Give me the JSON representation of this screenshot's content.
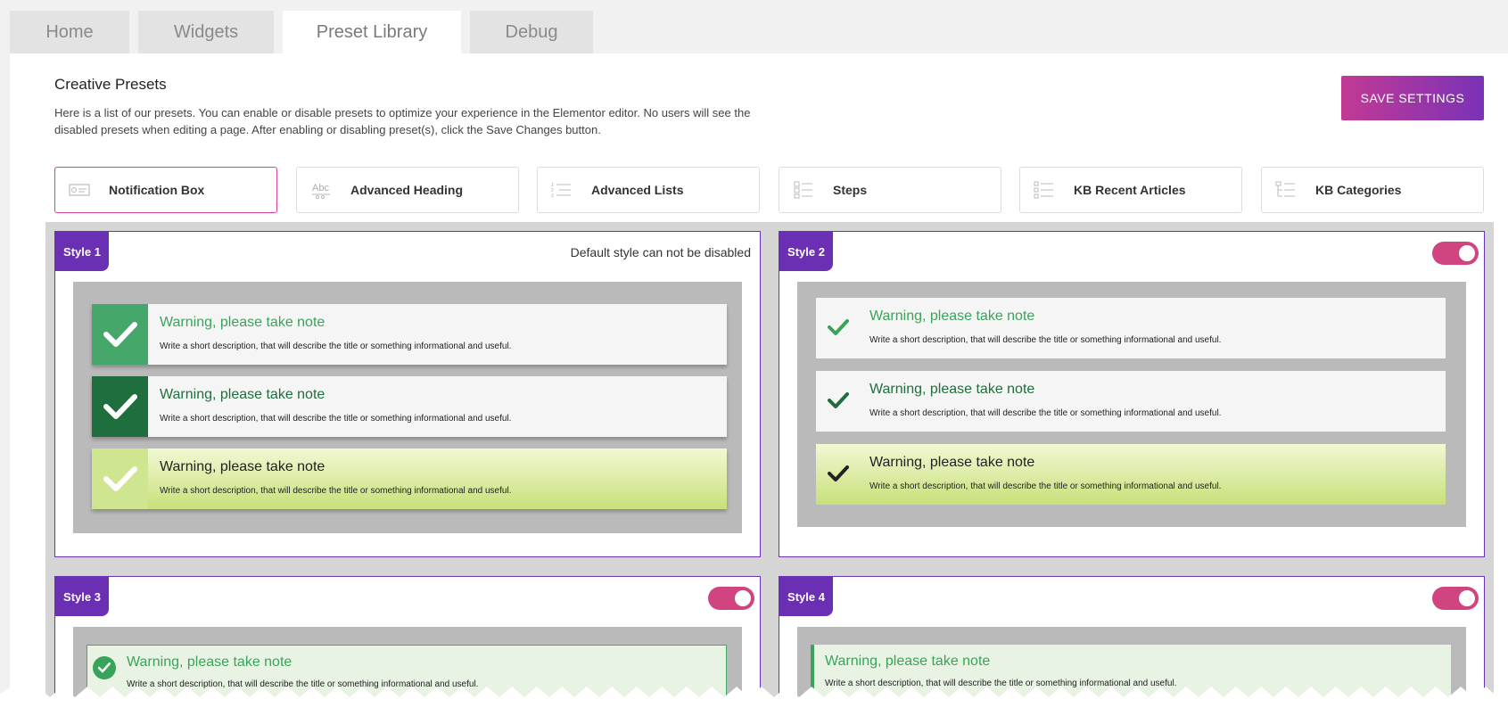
{
  "tabs": [
    {
      "label": "Home",
      "active": false
    },
    {
      "label": "Widgets",
      "active": false
    },
    {
      "label": "Preset Library",
      "active": true
    },
    {
      "label": "Debug",
      "active": false
    }
  ],
  "header": {
    "title": "Creative Presets",
    "description": "Here is a list of our presets. You can enable or disable presets to optimize your experience in the Elementor editor. No users will see the disabled presets when editing a page. After enabling or disabling preset(s), click the Save Changes button.",
    "save_label": "SAVE SETTINGS"
  },
  "preset_categories": [
    {
      "label": "Notification Box",
      "icon": "notification-box-icon",
      "active": true
    },
    {
      "label": "Advanced Heading",
      "icon": "heading-abc-icon",
      "active": false
    },
    {
      "label": "Advanced Lists",
      "icon": "numbered-list-icon",
      "active": false
    },
    {
      "label": "Steps",
      "icon": "steps-icon",
      "active": false
    },
    {
      "label": "KB Recent Articles",
      "icon": "list-tree-icon",
      "active": false
    },
    {
      "label": "KB Categories",
      "icon": "category-tree-icon",
      "active": false
    }
  ],
  "styles": [
    {
      "label": "Style 1",
      "note": "Default style can not be disabled",
      "enabled": true
    },
    {
      "label": "Style 2",
      "enabled": true
    },
    {
      "label": "Style 3",
      "enabled": true
    },
    {
      "label": "Style 4",
      "enabled": true
    }
  ],
  "notification": {
    "title": "Warning, please take note",
    "description": "Write a short description, that will describe the title or something informational and useful."
  },
  "colors": {
    "accent": "#d63e97",
    "purple": "#6b2fb3",
    "green_light": "#3aa35a",
    "green_dark": "#1f6e3d",
    "lime": "#c8e07a"
  }
}
